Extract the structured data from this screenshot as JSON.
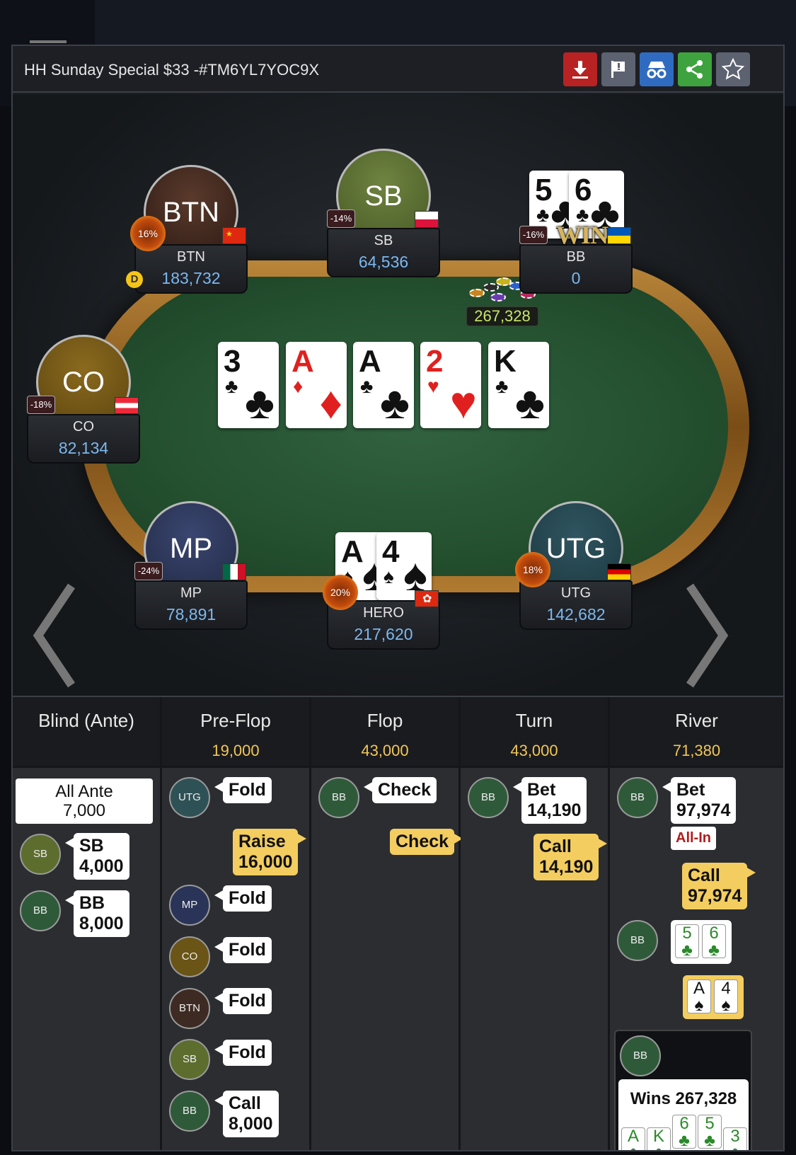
{
  "title": "HH Sunday Special $33 -#TM6YL7YOC9X",
  "toolbar": {
    "download_icon": "download-icon",
    "flag_icon": "report-flag-icon",
    "incognito_icon": "incognito-icon",
    "share_icon": "share-icon",
    "star_icon": "star-icon"
  },
  "colors": {
    "download": "#b82222",
    "flag": "#5d6271",
    "incognito": "#2f6cc1",
    "share": "#3ea33e",
    "star": "#5d6271",
    "stack": "#7cb8ef",
    "pot": "#c9e56e",
    "street_pot": "#f1c75a"
  },
  "seats": {
    "btn": {
      "avatar": "BTN",
      "name": "BTN",
      "stack": "183,732",
      "pct": "16%"
    },
    "sb": {
      "avatar": "SB",
      "name": "SB",
      "stack": "64,536",
      "pct": "-14%"
    },
    "bb": {
      "name": "BB",
      "stack": "0",
      "pct": "-16%",
      "win": "WIN",
      "cards": [
        {
          "rank": "5",
          "suit": "♣"
        },
        {
          "rank": "6",
          "suit": "♣"
        }
      ]
    },
    "co": {
      "avatar": "CO",
      "name": "CO",
      "stack": "82,134",
      "pct": "-18%"
    },
    "mp": {
      "avatar": "MP",
      "name": "MP",
      "stack": "78,891",
      "pct": "-24%"
    },
    "hero": {
      "name": "HERO",
      "stack": "217,620",
      "pct": "20%",
      "cards": [
        {
          "rank": "A",
          "suit": "♠"
        },
        {
          "rank": "4",
          "suit": "♠"
        }
      ]
    },
    "utg": {
      "avatar": "UTG",
      "name": "UTG",
      "stack": "142,682",
      "pct": "18%"
    }
  },
  "dealer_button": "D",
  "pot": "267,328",
  "board": [
    {
      "rank": "3",
      "suit": "♣",
      "color": "blk"
    },
    {
      "rank": "A",
      "suit": "♦",
      "color": "red"
    },
    {
      "rank": "A",
      "suit": "♣",
      "color": "blk"
    },
    {
      "rank": "2",
      "suit": "♥",
      "color": "red"
    },
    {
      "rank": "K",
      "suit": "♣",
      "color": "blk"
    }
  ],
  "streets": [
    {
      "name": "Blind (Ante)",
      "pot": ""
    },
    {
      "name": "Pre-Flop",
      "pot": "19,000"
    },
    {
      "name": "Flop",
      "pot": "43,000"
    },
    {
      "name": "Turn",
      "pot": "43,000"
    },
    {
      "name": "River",
      "pot": "71,380"
    }
  ],
  "blind": {
    "ante_label": "All Ante",
    "ante_amount": "7,000",
    "sb_chip": "SB",
    "sb_action": "SB",
    "sb_amount": "4,000",
    "bb_chip": "BB",
    "bb_action": "BB",
    "bb_amount": "8,000"
  },
  "preflop": [
    {
      "chip": "UTG",
      "action": "Fold"
    },
    {
      "action": "Raise",
      "amount": "16,000"
    },
    {
      "chip": "MP",
      "action": "Fold"
    },
    {
      "chip": "CO",
      "action": "Fold"
    },
    {
      "chip": "BTN",
      "action": "Fold"
    },
    {
      "chip": "SB",
      "action": "Fold"
    },
    {
      "chip": "BB",
      "action": "Call",
      "amount": "8,000"
    }
  ],
  "flop": [
    {
      "chip": "BB",
      "action": "Check"
    },
    {
      "action": "Check"
    }
  ],
  "turn": [
    {
      "chip": "BB",
      "action": "Bet",
      "amount": "14,190"
    },
    {
      "action": "Call",
      "amount": "14,190"
    }
  ],
  "river": {
    "bet_chip": "BB",
    "bet_action": "Bet",
    "bet_amount": "97,974",
    "allin": "All-In",
    "call_action": "Call",
    "call_amount": "97,974",
    "show_chip": "BB",
    "bb_show": [
      {
        "rank": "5",
        "suit": "♣"
      },
      {
        "rank": "6",
        "suit": "♣"
      }
    ],
    "hero_show": [
      {
        "rank": "A",
        "suit": "♠"
      },
      {
        "rank": "4",
        "suit": "♠"
      }
    ],
    "win_chip": "BB",
    "wins": "Wins 267,328",
    "win_hand": [
      {
        "rank": "A",
        "suit": "♣"
      },
      {
        "rank": "K",
        "suit": "♣"
      },
      {
        "rank": "6",
        "suit": "♣"
      },
      {
        "rank": "5",
        "suit": "♣"
      },
      {
        "rank": "3",
        "suit": "♣"
      }
    ]
  }
}
